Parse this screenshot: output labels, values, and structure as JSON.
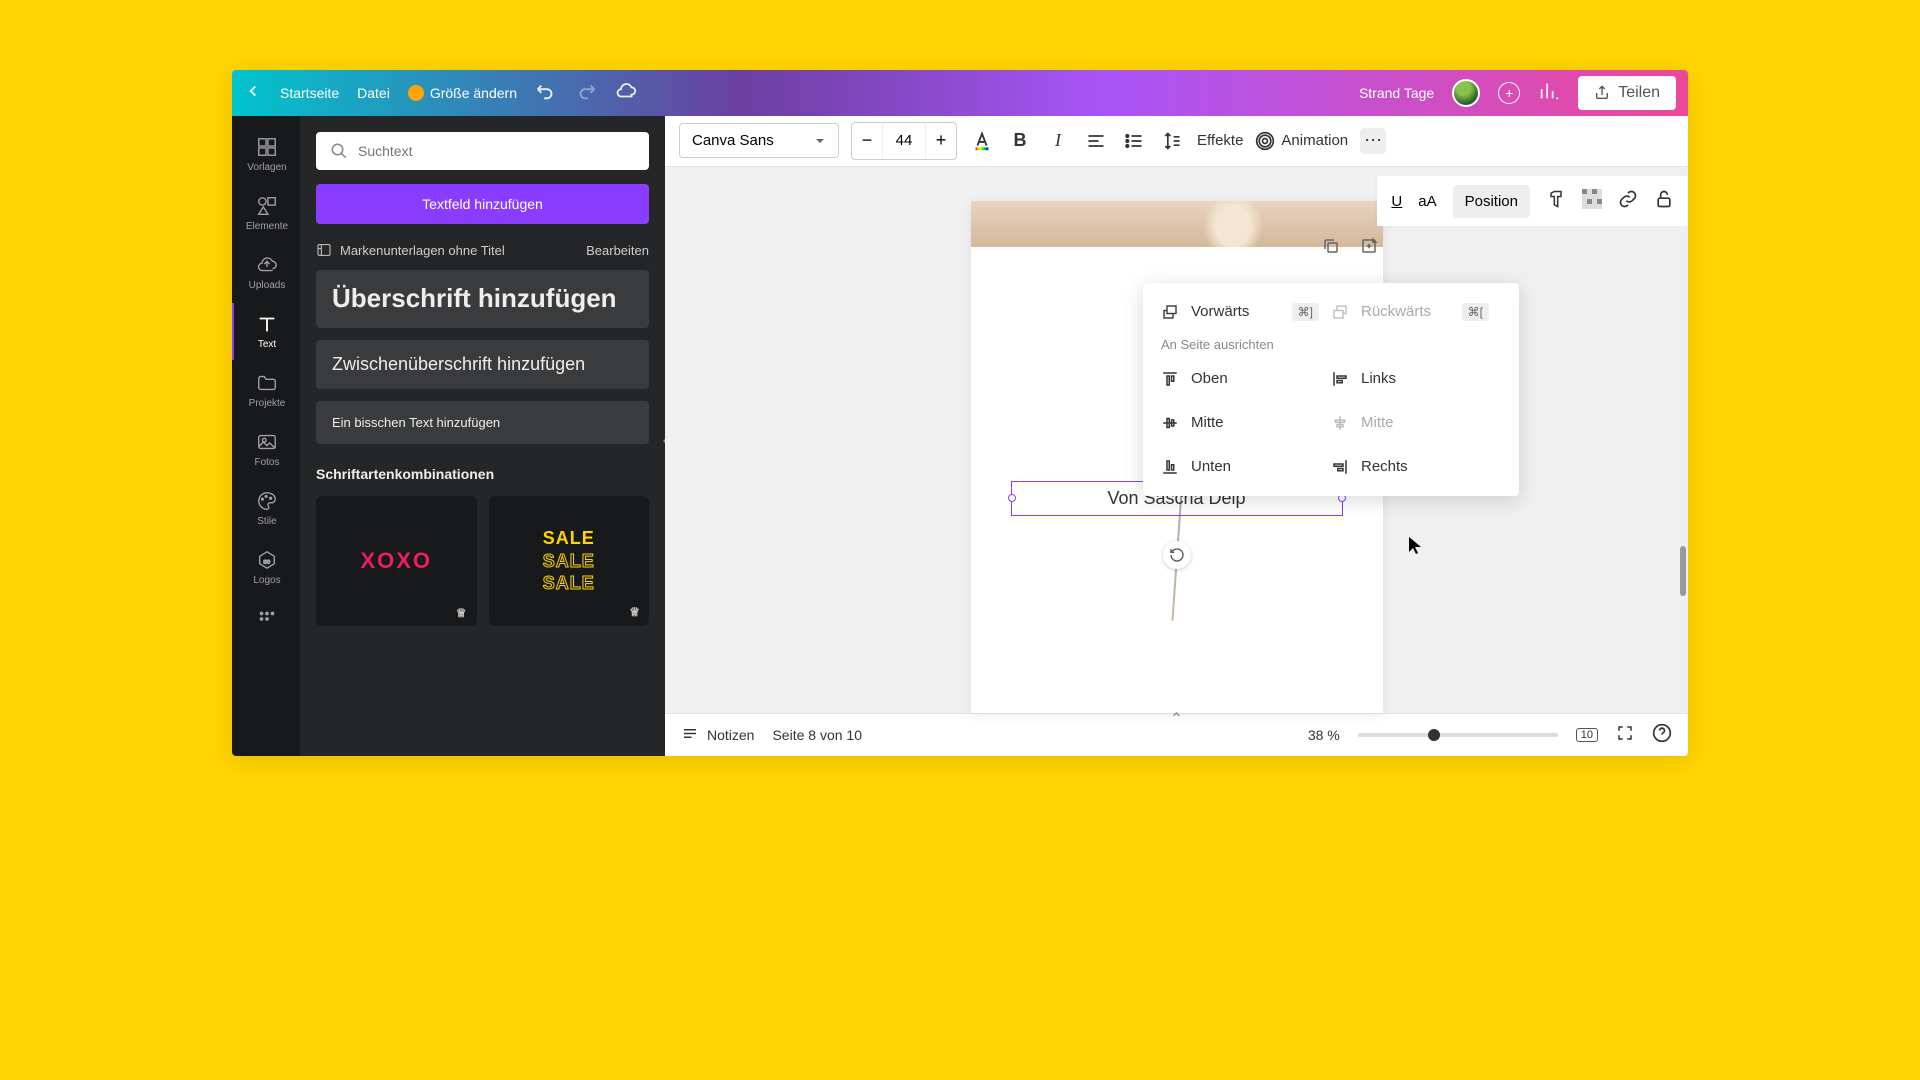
{
  "header": {
    "home": "Startseite",
    "file": "Datei",
    "resize": "Größe ändern",
    "project_name": "Strand Tage",
    "share": "Teilen"
  },
  "rail": {
    "templates": "Vorlagen",
    "elements": "Elemente",
    "uploads": "Uploads",
    "text": "Text",
    "projects": "Projekte",
    "photos": "Fotos",
    "styles": "Stile",
    "logos": "Logos"
  },
  "panel": {
    "search_placeholder": "Suchtext",
    "add_textfield": "Textfeld hinzufügen",
    "brand_docs": "Markenunterlagen ohne Titel",
    "edit": "Bearbeiten",
    "heading": "Überschrift hinzufügen",
    "subheading": "Zwischenüberschrift hinzufügen",
    "body": "Ein bisschen Text hinzufügen",
    "font_combos": "Schriftartenkombinationen",
    "combo1": "XOXO",
    "combo2": "SALE"
  },
  "toolbar": {
    "font": "Canva Sans",
    "size": "44",
    "effects": "Effekte",
    "animation": "Animation"
  },
  "toolbar2": {
    "underline": "U",
    "case": "aA",
    "position": "Position"
  },
  "popup": {
    "forward": "Vorwärts",
    "forward_key": "⌘]",
    "backward": "Rückwärts",
    "backward_key": "⌘[",
    "align_header": "An Seite ausrichten",
    "top": "Oben",
    "left": "Links",
    "middle_v": "Mitte",
    "middle_h": "Mitte",
    "bottom": "Unten",
    "right": "Rechts"
  },
  "canvas": {
    "selected_text": "Von Sascha Delp"
  },
  "footer": {
    "notes": "Notizen",
    "page_info": "Seite 8 von 10",
    "zoom": "38 %",
    "page_count": "10"
  }
}
